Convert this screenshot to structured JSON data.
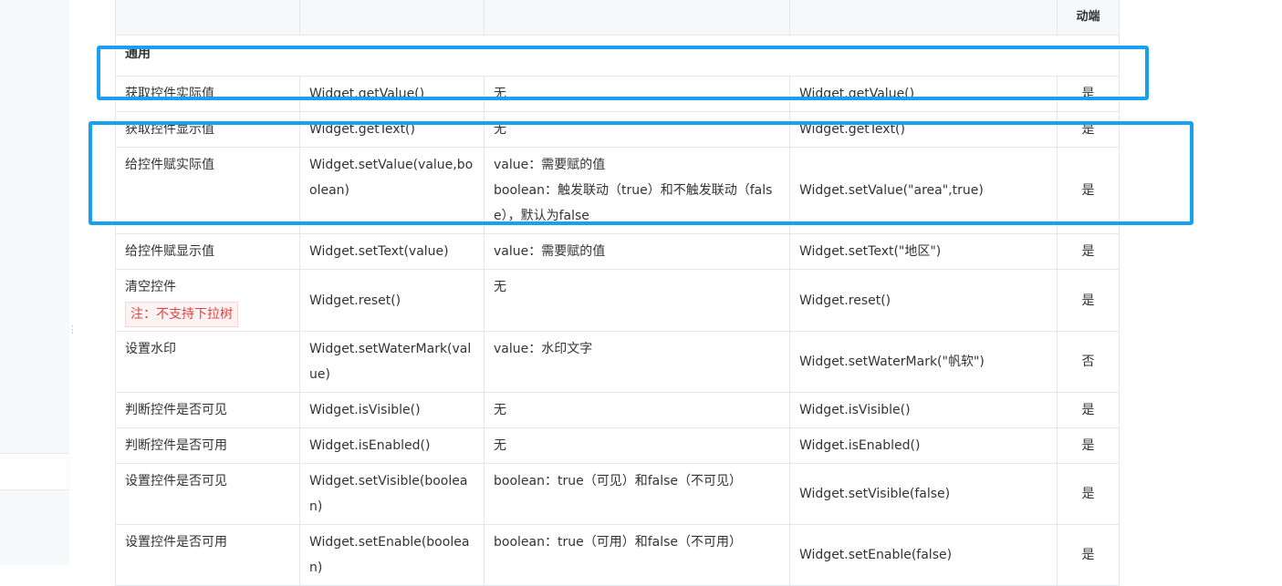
{
  "header": {
    "last_col_label": "动端"
  },
  "group_label": "通用",
  "rows": [
    {
      "name": "获取控件实际值",
      "method": "Widget.getValue()",
      "params": [
        "无"
      ],
      "example": "Widget.getValue()",
      "mobile": "是"
    },
    {
      "name": "获取控件显示值",
      "method": "Widget.getText()",
      "params": [
        "无"
      ],
      "example": "Widget.getText()",
      "mobile": "是"
    },
    {
      "name": "给控件赋实际值",
      "method": "Widget.setValue(value,boolean)",
      "params": [
        "value：需要赋的值",
        "boolean：触发联动（true）和不触发联动（false），默认为false"
      ],
      "example": "Widget.setValue(\"area\",true)",
      "mobile": "是"
    },
    {
      "name": "给控件赋显示值",
      "method": "Widget.setText(value)",
      "params": [
        "value：需要赋的值"
      ],
      "example": "Widget.setText(\"地区\")",
      "mobile": "是"
    },
    {
      "name": "清空控件",
      "note": "注：不支持下拉树",
      "method": "Widget.reset()",
      "params": [
        "无"
      ],
      "example": "Widget.reset()",
      "mobile": "是"
    },
    {
      "name": "设置水印",
      "method": "Widget.setWaterMark(value)",
      "params": [
        "value：水印文字"
      ],
      "example": "Widget.setWaterMark(\"帆软\")",
      "mobile": "否"
    },
    {
      "name": "判断控件是否可见",
      "method": "Widget.isVisible()",
      "params": [
        "无"
      ],
      "example": "Widget.isVisible()",
      "mobile": "是"
    },
    {
      "name": "判断控件是否可用",
      "method": "Widget.isEnabled()",
      "params": [
        "无"
      ],
      "example": "Widget.isEnabled()",
      "mobile": "是"
    },
    {
      "name": "设置控件是否可见",
      "method": "Widget.setVisible(boolean)",
      "params": [
        "boolean：true（可见）和false（不可见）"
      ],
      "example": "Widget.setVisible(false)",
      "mobile": "是"
    },
    {
      "name": "设置控件是否可用",
      "method": "Widget.setEnable(boolean)",
      "params": [
        "boolean：true（可用）和false（不可用）"
      ],
      "example": "Widget.setEnable(false)",
      "mobile": "是"
    }
  ],
  "colors": {
    "highlight": "#1aa0f0",
    "note_text": "#e04545",
    "border": "#e4e6ea"
  }
}
